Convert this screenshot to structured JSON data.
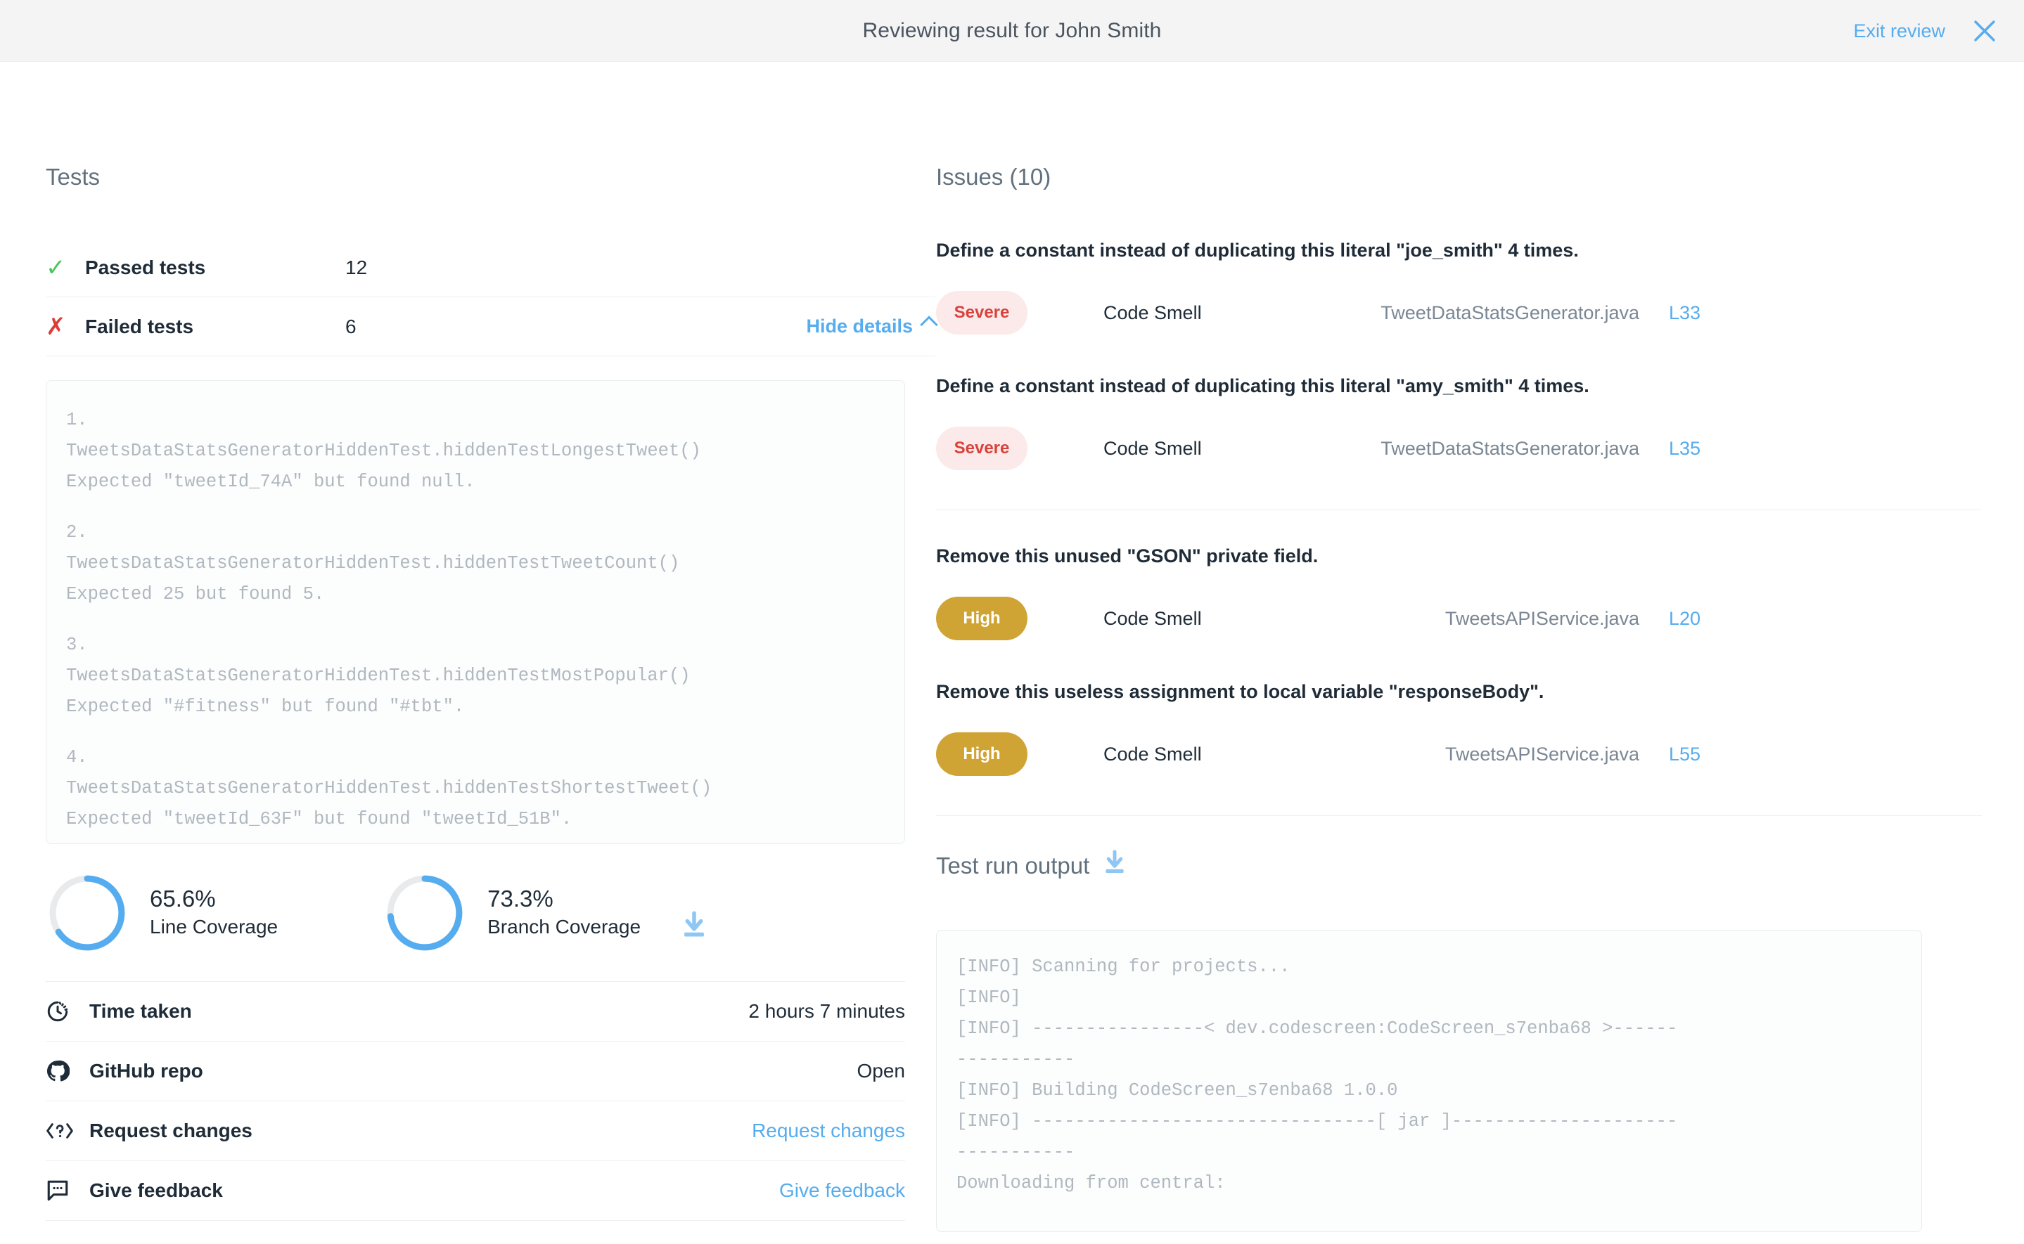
{
  "header": {
    "title": "Reviewing result for John Smith",
    "exit_label": "Exit review",
    "close_icon": "close-icon"
  },
  "tests": {
    "section_title": "Tests",
    "passed": {
      "label": "Passed tests",
      "value": "12",
      "icon": "check-icon"
    },
    "failed": {
      "label": "Failed tests",
      "value": "6",
      "icon": "cross-icon"
    },
    "toggle_details_label": "Hide details",
    "failures": [
      {
        "index": "1.",
        "test": "TweetsDataStatsGeneratorHiddenTest.hiddenTestLongestTweet()",
        "message": "Expected \"tweetId_74A\" but found null."
      },
      {
        "index": "2.",
        "test": "TweetsDataStatsGeneratorHiddenTest.hiddenTestTweetCount()",
        "message": "Expected 25 but found 5."
      },
      {
        "index": "3.",
        "test": "TweetsDataStatsGeneratorHiddenTest.hiddenTestMostPopular()",
        "message": "Expected \"#fitness\" but found \"#tbt\"."
      },
      {
        "index": "4.",
        "test": "TweetsDataStatsGeneratorHiddenTest.hiddenTestShortestTweet()",
        "message": "Expected \"tweetId_63F\" but found \"tweetId_51B\"."
      }
    ]
  },
  "coverage": {
    "line": {
      "percent": "65.6%",
      "label": "Line Coverage",
      "value": 65.6
    },
    "branch": {
      "percent": "73.3%",
      "label": "Branch Coverage",
      "value": 73.3
    },
    "download_icon": "download-icon",
    "ring_color": "#55acee",
    "track_color": "#e9eaec"
  },
  "info_rows": [
    {
      "icon": "timer-icon",
      "label": "Time taken",
      "value": "2 hours 7 minutes",
      "link": false
    },
    {
      "icon": "github-icon",
      "label": "GitHub repo",
      "value": "Open",
      "link": false
    },
    {
      "icon": "code-icon",
      "label": "Request changes",
      "value": "Request changes",
      "link": true
    },
    {
      "icon": "comment-icon",
      "label": "Give feedback",
      "value": "Give feedback",
      "link": true
    }
  ],
  "issues": {
    "section_title": "Issues (10)",
    "count": 10,
    "items": [
      {
        "title": "Define a constant instead of duplicating this literal \"joe_smith\" 4 times.",
        "severity": "Severe",
        "severity_class": "severe",
        "type": "Code Smell",
        "file": "TweetDataStatsGenerator.java",
        "line": "L33"
      },
      {
        "title": "Define a constant instead of duplicating this literal \"amy_smith\" 4 times.",
        "severity": "Severe",
        "severity_class": "severe",
        "type": "Code Smell",
        "file": "TweetDataStatsGenerator.java",
        "line": "L35"
      },
      {
        "title": "Remove this unused \"GSON\" private field.",
        "severity": "High",
        "severity_class": "high",
        "type": "Code Smell",
        "file": "TweetsAPIService.java",
        "line": "L20"
      },
      {
        "title": "Remove this useless assignment to local variable \"responseBody\".",
        "severity": "High",
        "severity_class": "high",
        "type": "Code Smell",
        "file": "TweetsAPIService.java",
        "line": "L55"
      }
    ]
  },
  "test_run_output": {
    "section_title": "Test run output",
    "download_icon": "download-icon",
    "lines": [
      "[INFO] Scanning for projects...",
      "[INFO] ",
      "[INFO] ----------------< dev.codescreen:CodeScreen_s7enba68 >------",
      "-----------",
      "[INFO] Building CodeScreen_s7enba68 1.0.0",
      "[INFO] --------------------------------[ jar ]---------------------",
      "-----------",
      "Downloading from central:"
    ]
  },
  "colors": {
    "accent": "#55acee",
    "pass": "#4cc35e",
    "fail": "#dc3c35",
    "severe_bg": "#fbeae9",
    "severe_fg": "#d9423c",
    "high_bg": "#cfa434",
    "header_bg": "#f4f4f4"
  }
}
